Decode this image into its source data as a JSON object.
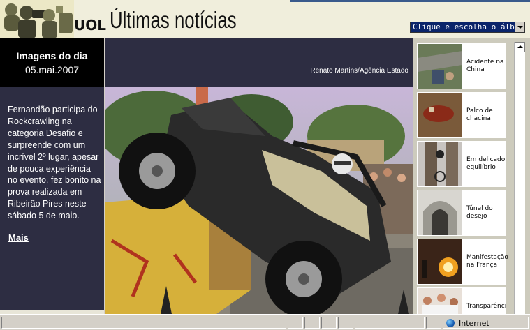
{
  "header": {
    "brand": "UOL",
    "section_title": "Últimas notícias",
    "album_select": {
      "selected": "Clique e escolha o álbum"
    }
  },
  "left_panel": {
    "date_label": "Imagens do dia",
    "date_value": "05.mai.2007",
    "caption": "Fernandão participa do Rockcrawling na categoria Desafio e surpreende com um incrível 2º lugar, apesar de pouca experiência no evento, fez bonito na prova realizada em Ribeirão Pires neste sábado 5 de maio.",
    "more_link": "Mais"
  },
  "photo": {
    "credit": "Renato Martins/Agência Estado",
    "subject": "jeep-rockcrawling"
  },
  "sidebar": {
    "items": [
      {
        "label": "Acidente na China",
        "icon": "thumb-accident"
      },
      {
        "label": "Palco de chacina",
        "icon": "thumb-crime-scene"
      },
      {
        "label": "Em delicado equilíbrio",
        "icon": "thumb-motorbike"
      },
      {
        "label": "Túnel do desejo",
        "icon": "thumb-tunnel"
      },
      {
        "label": "Manifestação na França",
        "icon": "thumb-fire"
      },
      {
        "label": "Transparência",
        "icon": "thumb-crowd"
      }
    ]
  },
  "statusbar": {
    "message": "",
    "zone_label": "Internet",
    "zone_icon": "globe-icon"
  },
  "colors": {
    "panel_dark": "#2d2d42",
    "date_box": "#000000",
    "header_bg": "#f0eedc",
    "sidebar_bg": "#cdcbbd"
  }
}
